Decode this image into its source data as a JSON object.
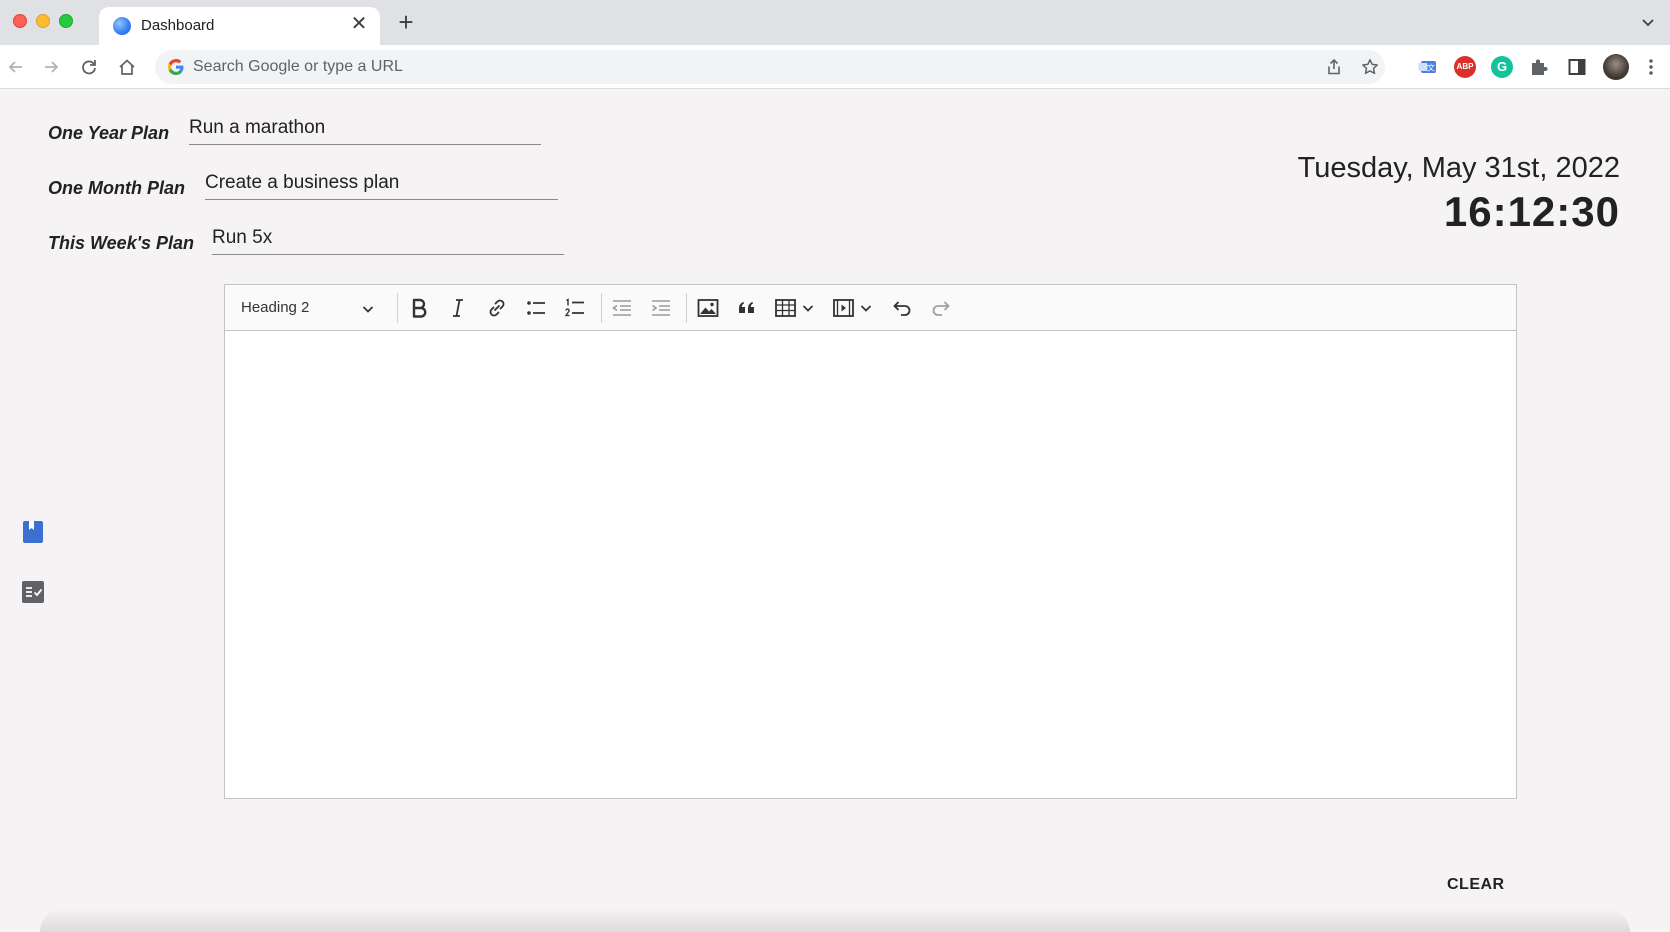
{
  "browser": {
    "tab_title": "Dashboard",
    "omnibox_placeholder": "Search Google or type a URL",
    "extensions": [
      "translate-icon",
      "adblock-icon",
      "grammarly-icon",
      "puzzle-icon",
      "sidebar-icon"
    ],
    "abp_label": "ABP",
    "grammarly_label": "G"
  },
  "plans": {
    "year_label": "One Year Plan",
    "year_value": "Run a marathon",
    "month_label": "One Month Plan",
    "month_value": "Create a business plan",
    "week_label": "This Week's Plan",
    "week_value": "Run 5x"
  },
  "clock": {
    "date": "Tuesday, May 31st, 2022",
    "time": "16:12:30"
  },
  "editor": {
    "heading_select": "Heading 2",
    "content": ""
  },
  "actions": {
    "clear_label": "CLEAR"
  },
  "colors": {
    "accent": "#3b6fd0",
    "page_bg": "#f5f3f4"
  }
}
